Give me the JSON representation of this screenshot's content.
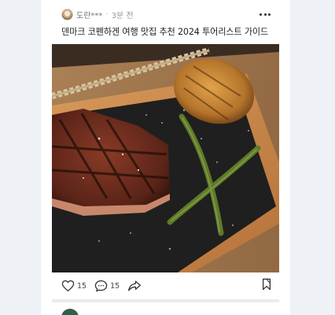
{
  "post": {
    "author": "도란***",
    "separator": "·",
    "time": "3분 전",
    "title": "덴마크 코펜하겐 여행 맛집 추천 2024 투어리스트 가이드",
    "image": {
      "subject": "grilled steak with grilled asparagus and roasted potato on slate board",
      "colors": {
        "board": "#c88a4e",
        "slate": "#232323",
        "steak": "#6a2c20",
        "potato": "#c98a3a",
        "asparagus": "#5a6a2a"
      }
    },
    "actions": {
      "likes": "15",
      "comments": "15"
    },
    "icons": {
      "like": "heart-icon",
      "comment": "comment-icon",
      "share": "share-icon",
      "bookmark": "bookmark-icon",
      "more": "more-dots-icon"
    }
  },
  "colors": {
    "page_bg": "#eef1f5",
    "card_bg": "#ffffff",
    "text": "#222222",
    "muted": "#777777"
  }
}
